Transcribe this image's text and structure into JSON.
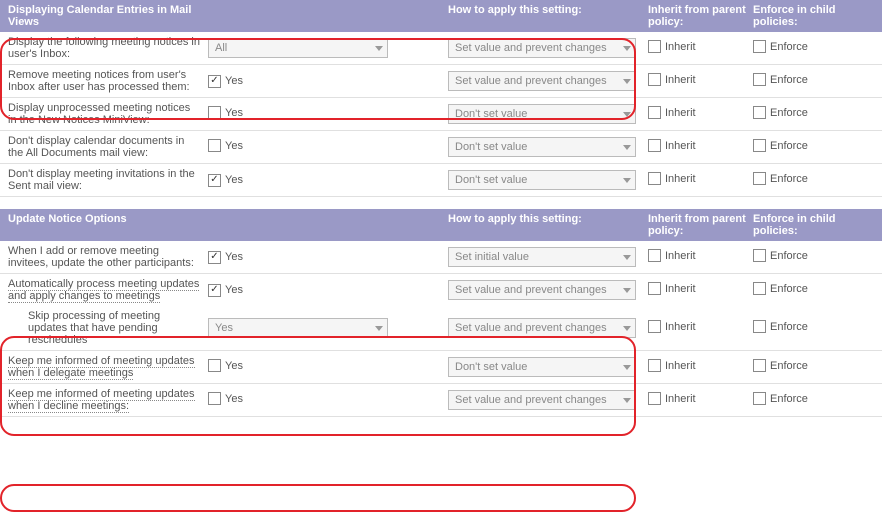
{
  "sections": {
    "calendar": {
      "title": "Displaying Calendar Entries in Mail Views",
      "h_apply": "How to apply this setting:",
      "h_inherit": "Inherit from parent policy:",
      "h_enforce": "Enforce in child policies:"
    },
    "update": {
      "title": "Update Notice Options",
      "h_apply": "How to apply this setting:",
      "h_inherit": "Inherit from parent policy:",
      "h_enforce": "Enforce in child policies:"
    }
  },
  "labels": {
    "yes": "Yes",
    "inherit": "Inherit",
    "enforce": "Enforce"
  },
  "apply_opts": {
    "prevent": "Set value and prevent changes",
    "dont": "Don't set value",
    "initial": "Set initial value"
  },
  "rows": {
    "r1": {
      "label": "Display the following meeting notices in user's Inbox:",
      "value": "All"
    },
    "r2": {
      "label": "Remove meeting notices from user's Inbox after user has processed them:"
    },
    "r3": {
      "label": "Display unprocessed meeting notices in the New Notices MiniView:"
    },
    "r4": {
      "label": "Don't display calendar documents in the All Documents mail view:"
    },
    "r5": {
      "label": "Don't display meeting invitations in the Sent mail view:"
    },
    "r6": {
      "label": "When I add or remove meeting invitees, update the other participants:"
    },
    "r7": {
      "label": "Automatically process meeting updates and apply changes to meetings"
    },
    "r8": {
      "label": "Skip processing of meeting updates that have pending reschedules",
      "value": "Yes"
    },
    "r9": {
      "label": "Keep me informed of meeting updates when I delegate meetings"
    },
    "r10": {
      "label": "Keep me informed of meeting updates when I decline meetings:"
    }
  }
}
